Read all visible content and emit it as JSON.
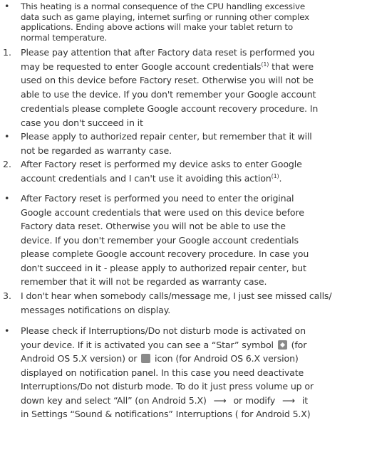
{
  "list": {
    "item_intro": {
      "bullet": "•",
      "lines": [
        "This heating is a normal consequence of the CPU handling excessive",
        "data such as game playing, internet surfing or running other complex",
        "applications. Ending above actions will make your tablet return to",
        "normal temperature."
      ]
    },
    "q1": {
      "number": "1.",
      "lines": [
        "Please pay attention that after Factory data reset is performed you",
        "may be requested to enter Google account credentials",
        " that were",
        "used on this device before Factory reset. Otherwise you will not be",
        "able to use the device. If you don't remember your Google account",
        "credentials please complete Google account recovery procedure. In",
        "case you don't succeed in it"
      ],
      "footnote": "(1)"
    },
    "a1": {
      "bullet": "•",
      "lines": [
        "Please apply to authorized repair center, but remember that it will",
        "not be regarded as warranty case."
      ]
    },
    "q2": {
      "number": "2.",
      "lines": [
        "After Factory reset is performed my device asks to enter Google",
        "account credentials and I can't use it avoiding this action",
        "."
      ],
      "footnote": "(1)"
    },
    "a2": {
      "bullet": "•",
      "lines": [
        "After Factory reset is performed you need to enter the original",
        "Google account credentials that were used on this device before",
        "Factory data reset. Otherwise you will not be able to use the",
        "device. If you don't remember your Google account credentials",
        "please complete Google account recovery procedure. In case you",
        "don't succeed in it - please apply to authorized repair center, but",
        "remember that it will not be regarded as warranty case."
      ]
    },
    "q3": {
      "number": "3.",
      "lines": [
        "I don't hear when somebody calls/message me, I just see missed calls/",
        "messages notifications on display."
      ]
    },
    "a3": {
      "bullet": "•",
      "lines": [
        "Please check if Interruptions/Do not disturb mode is activated on",
        "your device. If it is activated you can see a “Star” symbol",
        "(for",
        "Android OS 5.X version) or",
        "icon (for Android OS 6.X version)",
        "displayed on notification panel. In this case you need deactivate",
        "Interruptions/Do not disturb mode. To do it just press volume  up or",
        "down key and select “All” (on Android 5.X)",
        "or modify",
        "it",
        "in Settings “Sound & notifications” Interruptions ( for Android 5.X)"
      ],
      "arrow": "⟶",
      "icons": {
        "star_symbol": "star-icon",
        "dnd_symbol": "do-not-disturb-icon"
      }
    }
  }
}
